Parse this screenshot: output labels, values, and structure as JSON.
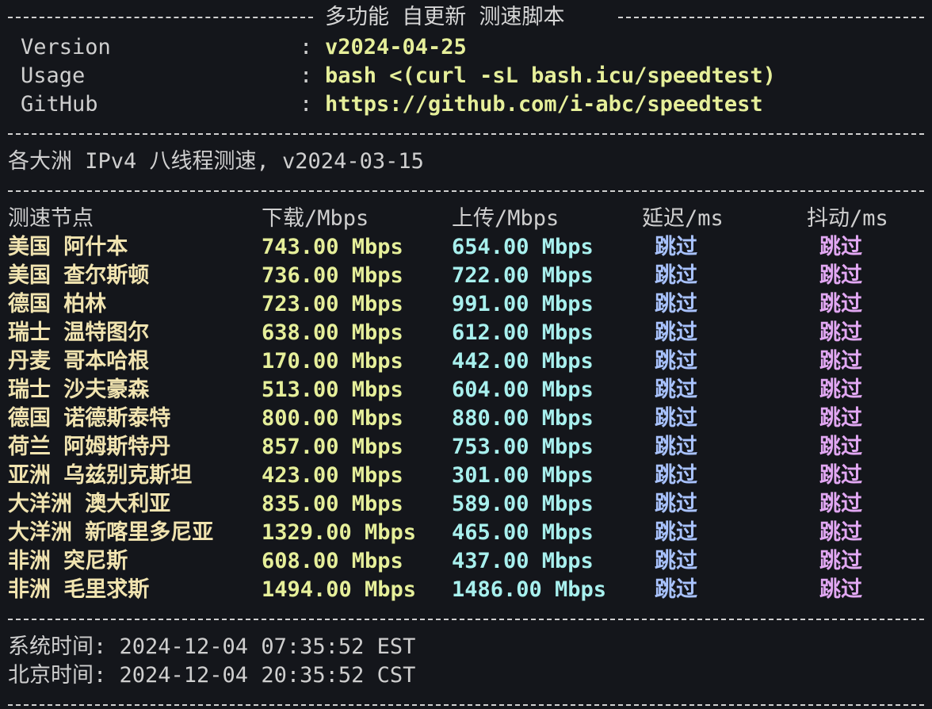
{
  "colors": {
    "background": "#14161b",
    "location": "#f1e4b0",
    "download": "#e6ef9a",
    "upload": "#a8f0ee",
    "latency": "#a9c3ff",
    "jitter": "#e2a8f3"
  },
  "banner": {
    "title": "多功能 自更新 测速脚本",
    "version_label": "Version",
    "version_value": "v2024-04-25",
    "usage_label": "Usage",
    "usage_value": "bash <(curl -sL bash.icu/speedtest)",
    "github_label": "GitHub",
    "github_value": "https://github.com/i-abc/speedtest",
    "colon": ":"
  },
  "test_title": "各大洲 IPv4 八线程测速, v2024-03-15",
  "table": {
    "headers": {
      "node": "测速节点",
      "download": "下载/Mbps",
      "upload": "上传/Mbps",
      "latency": "延迟/ms",
      "jitter": "抖动/ms"
    },
    "rows": [
      {
        "node": "美国 阿什本",
        "download": "743.00 Mbps",
        "upload": "654.00 Mbps",
        "latency": "跳过",
        "jitter": "跳过"
      },
      {
        "node": "美国 查尔斯顿",
        "download": "736.00 Mbps",
        "upload": "722.00 Mbps",
        "latency": "跳过",
        "jitter": "跳过"
      },
      {
        "node": "德国 柏林",
        "download": "723.00 Mbps",
        "upload": "991.00 Mbps",
        "latency": "跳过",
        "jitter": "跳过"
      },
      {
        "node": "瑞士 温特图尔",
        "download": "638.00 Mbps",
        "upload": "612.00 Mbps",
        "latency": "跳过",
        "jitter": "跳过"
      },
      {
        "node": "丹麦 哥本哈根",
        "download": "170.00 Mbps",
        "upload": "442.00 Mbps",
        "latency": "跳过",
        "jitter": "跳过"
      },
      {
        "node": "瑞士 沙夫豪森",
        "download": "513.00 Mbps",
        "upload": "604.00 Mbps",
        "latency": "跳过",
        "jitter": "跳过"
      },
      {
        "node": "德国 诺德斯泰特",
        "download": "800.00 Mbps",
        "upload": "880.00 Mbps",
        "latency": "跳过",
        "jitter": "跳过"
      },
      {
        "node": "荷兰 阿姆斯特丹",
        "download": "857.00 Mbps",
        "upload": "753.00 Mbps",
        "latency": "跳过",
        "jitter": "跳过"
      },
      {
        "node": "亚洲 乌兹别克斯坦",
        "download": "423.00 Mbps",
        "upload": "301.00 Mbps",
        "latency": "跳过",
        "jitter": "跳过"
      },
      {
        "node": "大洋洲 澳大利亚",
        "download": "835.00 Mbps",
        "upload": "589.00 Mbps",
        "latency": "跳过",
        "jitter": "跳过"
      },
      {
        "node": "大洋洲 新喀里多尼亚",
        "download": "1329.00 Mbps",
        "upload": "465.00 Mbps",
        "latency": "跳过",
        "jitter": "跳过"
      },
      {
        "node": "非洲 突尼斯",
        "download": "608.00 Mbps",
        "upload": "437.00 Mbps",
        "latency": "跳过",
        "jitter": "跳过"
      },
      {
        "node": "非洲 毛里求斯",
        "download": "1494.00 Mbps",
        "upload": "1486.00 Mbps",
        "latency": "跳过",
        "jitter": "跳过"
      }
    ]
  },
  "footer": {
    "system_time": "系统时间: 2024-12-04 07:35:52 EST",
    "beijing_time": "北京时间: 2024-12-04 20:35:52 CST"
  }
}
